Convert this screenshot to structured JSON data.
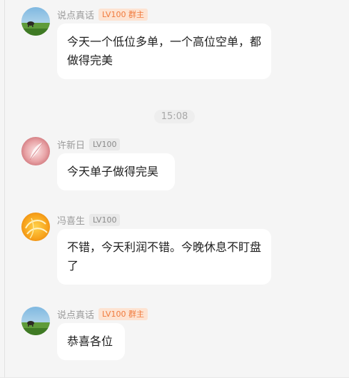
{
  "messages": [
    {
      "sender": "说点真话",
      "badge": "LV100 群主",
      "text": "今天一个低位多单，一个高位空单，都做得完美",
      "avatar_icon": "landscape-avatar-icon"
    },
    {
      "sender": "许新日",
      "badge": "LV100",
      "text": "今天单子做得完昊",
      "avatar_icon": "pink-feather-avatar-icon"
    },
    {
      "sender": "冯喜生",
      "badge": "LV100",
      "text": "不错，今天利润不错。今晚休息不盯盘了",
      "avatar_icon": "orange-abstract-avatar-icon"
    },
    {
      "sender": "说点真话",
      "badge": "LV100 群主",
      "text": "恭喜各位",
      "avatar_icon": "landscape-avatar-icon"
    }
  ],
  "timestamp": "15:08",
  "colors": {
    "background": "#f5f5f5",
    "bubble": "#ffffff",
    "owner_badge_bg": "#fde3d2",
    "owner_badge_text": "#f07a3c",
    "badge_bg": "#e9e9e9",
    "name_text": "#9a9a9a"
  }
}
